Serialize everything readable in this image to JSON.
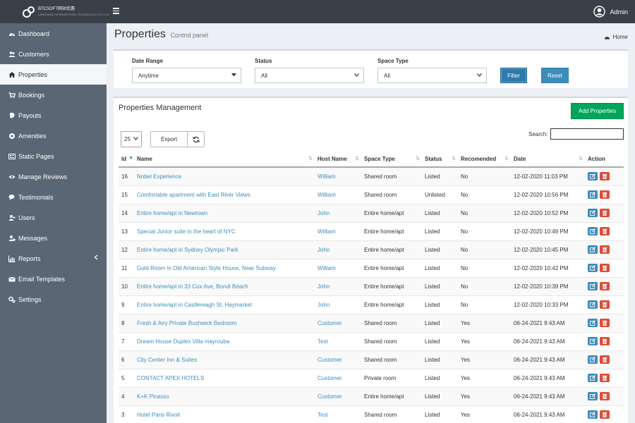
{
  "brand": {
    "name": "BTCSOFT网站优惠",
    "tagline": "LANGUAGE INTERNATIONAL TECHNOLOGY CO.,LTD"
  },
  "user": {
    "name": "Admin"
  },
  "sidebar": {
    "items": [
      {
        "label": "Dashboard",
        "icon": "dashboard-icon"
      },
      {
        "label": "Customers",
        "icon": "users-icon"
      },
      {
        "label": "Properties",
        "icon": "home-icon",
        "active": true
      },
      {
        "label": "Bookings",
        "icon": "cart-icon"
      },
      {
        "label": "Payouts",
        "icon": "money-icon"
      },
      {
        "label": "Amenities",
        "icon": "amenities-icon"
      },
      {
        "label": "Static Pages",
        "icon": "pages-icon"
      },
      {
        "label": "Manage Reviews",
        "icon": "eye-icon"
      },
      {
        "label": "Testimonials",
        "icon": "comments-icon"
      },
      {
        "label": "Users",
        "icon": "user-plus-icon"
      },
      {
        "label": "Messages",
        "icon": "messages-icon"
      },
      {
        "label": "Reports",
        "icon": "chart-icon"
      },
      {
        "label": "Email Templates",
        "icon": "envelope-icon"
      },
      {
        "label": "Settings",
        "icon": "cogs-icon"
      }
    ]
  },
  "header": {
    "title": "Properties",
    "subtitle": "Control panel",
    "breadcrumb": "Home"
  },
  "filters": {
    "date_range": {
      "label": "Date Range",
      "value": "Anytime"
    },
    "status": {
      "label": "Status",
      "value": "All"
    },
    "space_type": {
      "label": "Space Type",
      "value": "All"
    },
    "filter_button": "Filter",
    "reset_button": "Reset"
  },
  "table": {
    "title": "Properties Management",
    "add_button": "Add Properties",
    "page_size": "25",
    "export_button": "Export",
    "search_label": "Search:",
    "search_value": "",
    "columns": [
      "Id",
      "Name",
      "Host Name",
      "Space Type",
      "Status",
      "Recomended",
      "Date",
      "Action"
    ],
    "rows": [
      {
        "id": "16",
        "name": "Nobel Experience",
        "host": "William",
        "space": "Shared room",
        "status": "Listed",
        "rec": "No",
        "date": "12-02-2020 11:03 PM"
      },
      {
        "id": "15",
        "name": "Comfortable apartment with East River Views",
        "host": "William",
        "space": "Shared room",
        "status": "Unlisted",
        "rec": "No",
        "date": "12-02-2020 10:56 PM"
      },
      {
        "id": "14",
        "name": "Entire home/apt in Newtown",
        "host": "John",
        "space": "Entire home/apt",
        "status": "Listed",
        "rec": "No",
        "date": "12-02-2020 10:52 PM"
      },
      {
        "id": "13",
        "name": "Special Junior suite in the heart of NYC",
        "host": "William",
        "space": "Entire home/apt",
        "status": "Listed",
        "rec": "No",
        "date": "12-02-2020 10:49 PM"
      },
      {
        "id": "12",
        "name": "Entire home/apt in Sydney Olympic Park",
        "host": "John",
        "space": "Entire home/apt",
        "status": "Listed",
        "rec": "No",
        "date": "12-02-2020 10:45 PM"
      },
      {
        "id": "11",
        "name": "Gold Room in Old American Style House, Near Subway",
        "host": "William",
        "space": "Entire home/apt",
        "status": "Listed",
        "rec": "No",
        "date": "12-02-2020 10:42 PM"
      },
      {
        "id": "10",
        "name": "Entire home/apt in 33 Cox Ave, Bondi Beach",
        "host": "John",
        "space": "Entire home/apt",
        "status": "Listed",
        "rec": "No",
        "date": "12-02-2020 10:39 PM"
      },
      {
        "id": "9",
        "name": "Entire home/apt in Castlereagh St, Haymarket",
        "host": "John",
        "space": "Entire home/apt",
        "status": "Listed",
        "rec": "No",
        "date": "12-02-2020 10:33 PM"
      },
      {
        "id": "8",
        "name": "Fresh & Airy Private Bushwick Bedroom",
        "host": "Customer",
        "space": "Shared room",
        "status": "Listed",
        "rec": "Yes",
        "date": "06-24-2021 9:43 AM"
      },
      {
        "id": "7",
        "name": "Dream House Duplex Villa mayrouba",
        "host": "Test",
        "space": "Shared room",
        "status": "Listed",
        "rec": "Yes",
        "date": "06-24-2021 9:43 AM"
      },
      {
        "id": "6",
        "name": "City Center Inn & Suites",
        "host": "Customer",
        "space": "Shared room",
        "status": "Listed",
        "rec": "Yes",
        "date": "06-24-2021 9:43 AM"
      },
      {
        "id": "5",
        "name": "CONTACT APEX HOTELS",
        "host": "Customer",
        "space": "Private room",
        "status": "Listed",
        "rec": "Yes",
        "date": "06-24-2021 9:43 AM"
      },
      {
        "id": "4",
        "name": "K+K Picasso",
        "host": "Customer",
        "space": "Entire home/apt",
        "status": "Listed",
        "rec": "Yes",
        "date": "06-24-2021 9:43 AM"
      },
      {
        "id": "3",
        "name": "Hotel Paris Rivoli",
        "host": "Test",
        "space": "Shared room",
        "status": "Listed",
        "rec": "Yes",
        "date": "06-24-2021 9:43 AM"
      }
    ]
  },
  "colors": {
    "topbar": "#3a4048",
    "sidebar": "#5a6674",
    "accent": "#3c8dbc",
    "success": "#00a65a",
    "danger": "#dd4b39"
  }
}
